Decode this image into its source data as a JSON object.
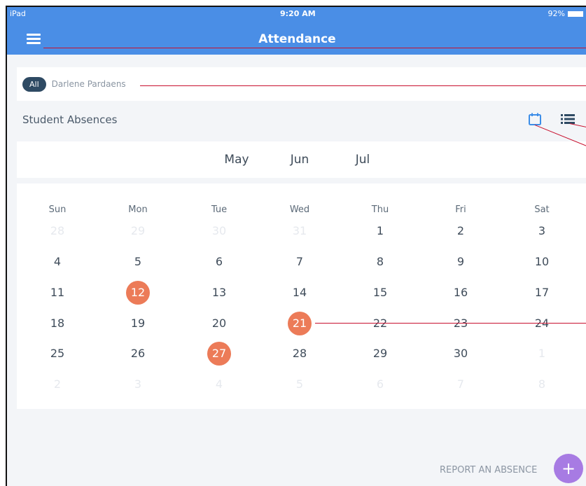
{
  "status_bar": {
    "carrier": "iPad",
    "time": "9:20 AM",
    "battery": "92%"
  },
  "header": {
    "title": "Attendance",
    "menu_icon": "hamburger-menu-icon"
  },
  "filter": {
    "all_label": "All",
    "student_name": "Darlene Pardaens"
  },
  "section": {
    "title": "Student Absences",
    "calendar_view_icon": "calendar-icon",
    "list_view_icon": "list-icon"
  },
  "months": [
    "May",
    "Jun",
    "Jul"
  ],
  "weekdays": [
    "Sun",
    "Mon",
    "Tue",
    "Wed",
    "Thu",
    "Fri",
    "Sat"
  ],
  "weeks": [
    [
      {
        "d": "28",
        "f": true
      },
      {
        "d": "29",
        "f": true
      },
      {
        "d": "30",
        "f": true
      },
      {
        "d": "31",
        "f": true
      },
      {
        "d": "1"
      },
      {
        "d": "2"
      },
      {
        "d": "3"
      }
    ],
    [
      {
        "d": "4"
      },
      {
        "d": "5"
      },
      {
        "d": "6"
      },
      {
        "d": "7"
      },
      {
        "d": "8"
      },
      {
        "d": "9"
      },
      {
        "d": "10"
      }
    ],
    [
      {
        "d": "11"
      },
      {
        "d": "12",
        "a": true
      },
      {
        "d": "13"
      },
      {
        "d": "14"
      },
      {
        "d": "15"
      },
      {
        "d": "16"
      },
      {
        "d": "17"
      }
    ],
    [
      {
        "d": "18"
      },
      {
        "d": "19"
      },
      {
        "d": "20"
      },
      {
        "d": "21",
        "a": true
      },
      {
        "d": "22",
        "s": true
      },
      {
        "d": "23",
        "s": true
      },
      {
        "d": "24",
        "s": true
      }
    ],
    [
      {
        "d": "25"
      },
      {
        "d": "26"
      },
      {
        "d": "27",
        "a": true
      },
      {
        "d": "28"
      },
      {
        "d": "29"
      },
      {
        "d": "30"
      },
      {
        "d": "1",
        "f": true
      }
    ],
    [
      {
        "d": "2",
        "f": true
      },
      {
        "d": "3",
        "f": true
      },
      {
        "d": "4",
        "f": true
      },
      {
        "d": "5",
        "f": true
      },
      {
        "d": "6",
        "f": true
      },
      {
        "d": "7",
        "f": true
      },
      {
        "d": "8",
        "f": true
      }
    ]
  ],
  "report": {
    "label": "REPORT AN ABSENCE",
    "button_symbol": "+"
  },
  "colors": {
    "header": "#4a8ee6",
    "absence": "#ec7b58",
    "fab": "#a77be3",
    "chip": "#2e4a63",
    "annotation": "#c8102e"
  }
}
